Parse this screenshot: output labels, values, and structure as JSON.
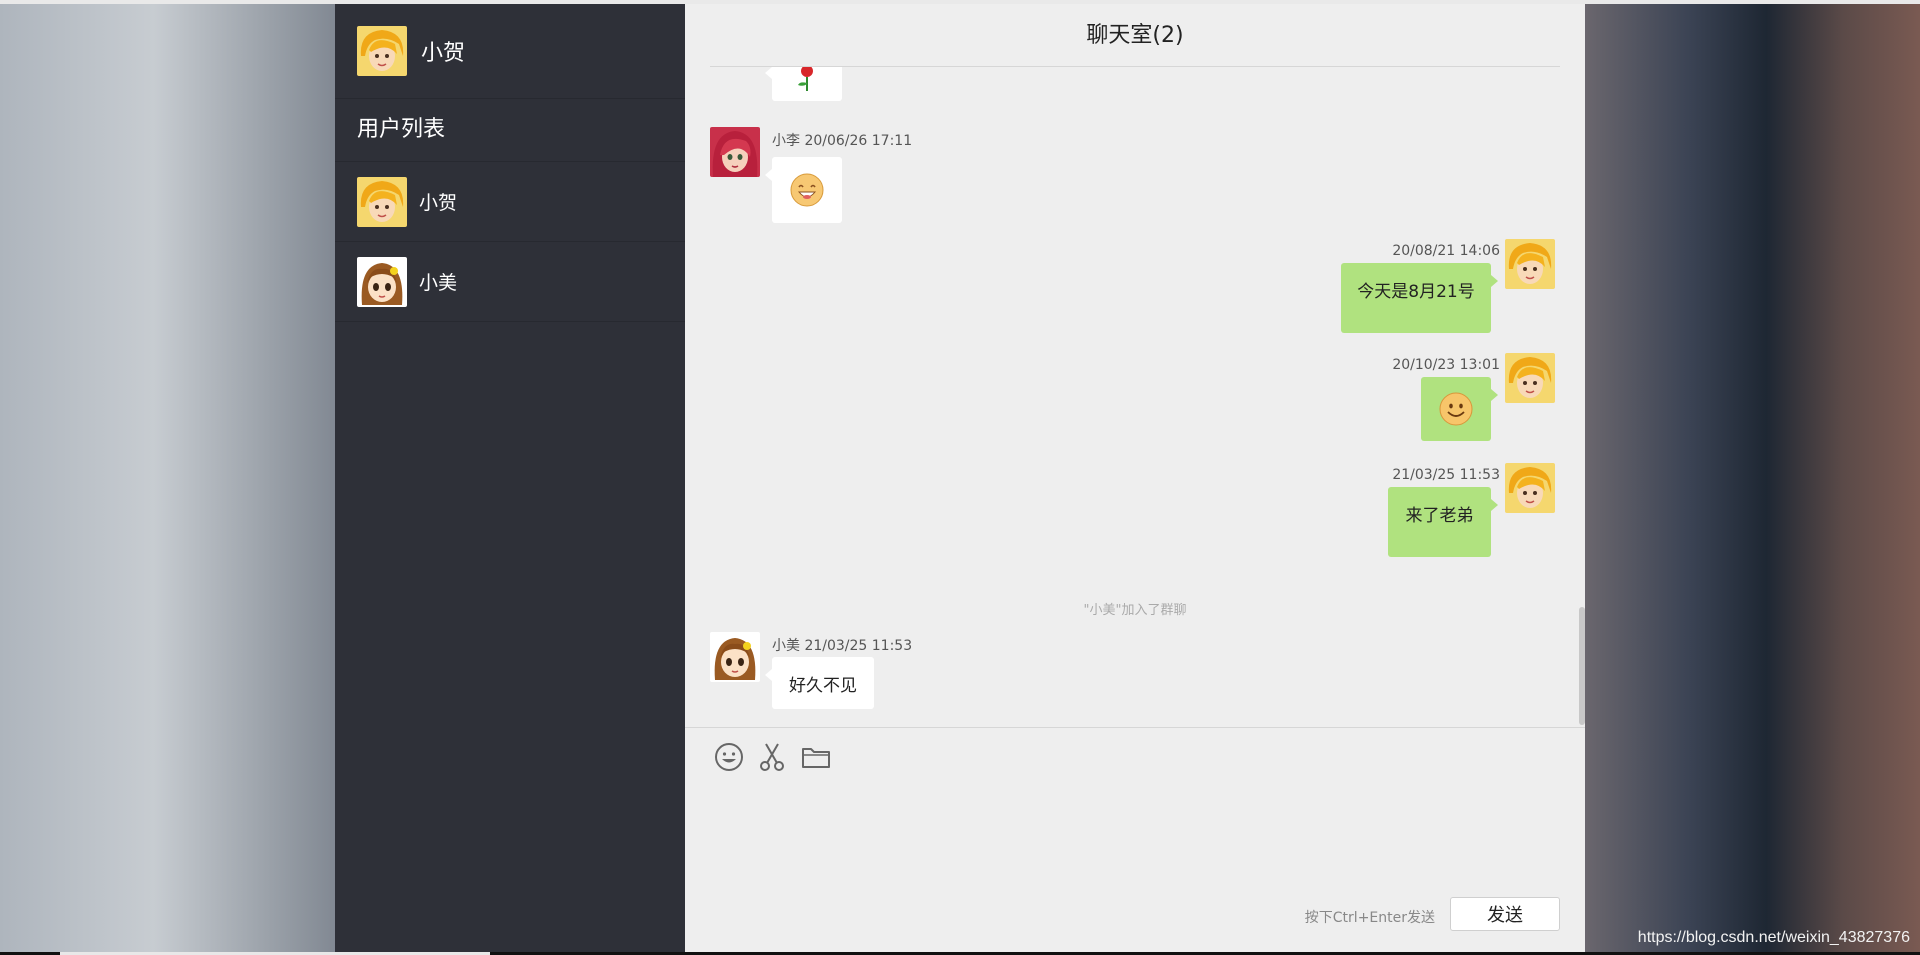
{
  "current_user": {
    "name": "小贺",
    "avatar": "blonde-girl-avatar"
  },
  "sidebar": {
    "list_title": "用户列表",
    "users": [
      {
        "name": "小贺",
        "avatar": "blonde-girl-avatar"
      },
      {
        "name": "小美",
        "avatar": "brown-hair-girl-avatar"
      }
    ]
  },
  "chat": {
    "title": "聊天室(2)",
    "messages": [
      {
        "sender": "",
        "time": "",
        "type": "image",
        "content": "rose-emoji",
        "side": "left"
      },
      {
        "sender": "小李",
        "time": "20/06/26 17:11",
        "type": "image",
        "content": "grin-face-emoji",
        "side": "left"
      },
      {
        "sender": "",
        "time": "20/08/21 14:06",
        "type": "text",
        "content": "今天是8月21号",
        "side": "right"
      },
      {
        "sender": "",
        "time": "20/10/23 13:01",
        "type": "image",
        "content": "smile-face-emoji",
        "side": "right"
      },
      {
        "sender": "",
        "time": "21/03/25 11:53",
        "type": "text",
        "content": "来了老弟",
        "side": "right"
      },
      {
        "sender": "小美",
        "time": "21/03/25 11:53",
        "type": "text",
        "content": "好久不见",
        "side": "left"
      }
    ],
    "system_notice": "\"小美\"加入了群聊",
    "meta_1": "小李 20/06/26 17:11",
    "meta_5": "小美 21/03/25 11:53"
  },
  "toolbar": {
    "icons": [
      "emoji-icon",
      "scissors-icon",
      "folder-icon"
    ]
  },
  "composer": {
    "hint": "按下Ctrl+Enter发送",
    "send_label": "发送"
  },
  "watermark": "https://blog.csdn.net/weixin_43827376",
  "colors": {
    "sidebar": "#2e3038",
    "chat_bg": "#eeeeee",
    "self_bubble": "#b0e27f",
    "other_bubble": "#ffffff"
  }
}
